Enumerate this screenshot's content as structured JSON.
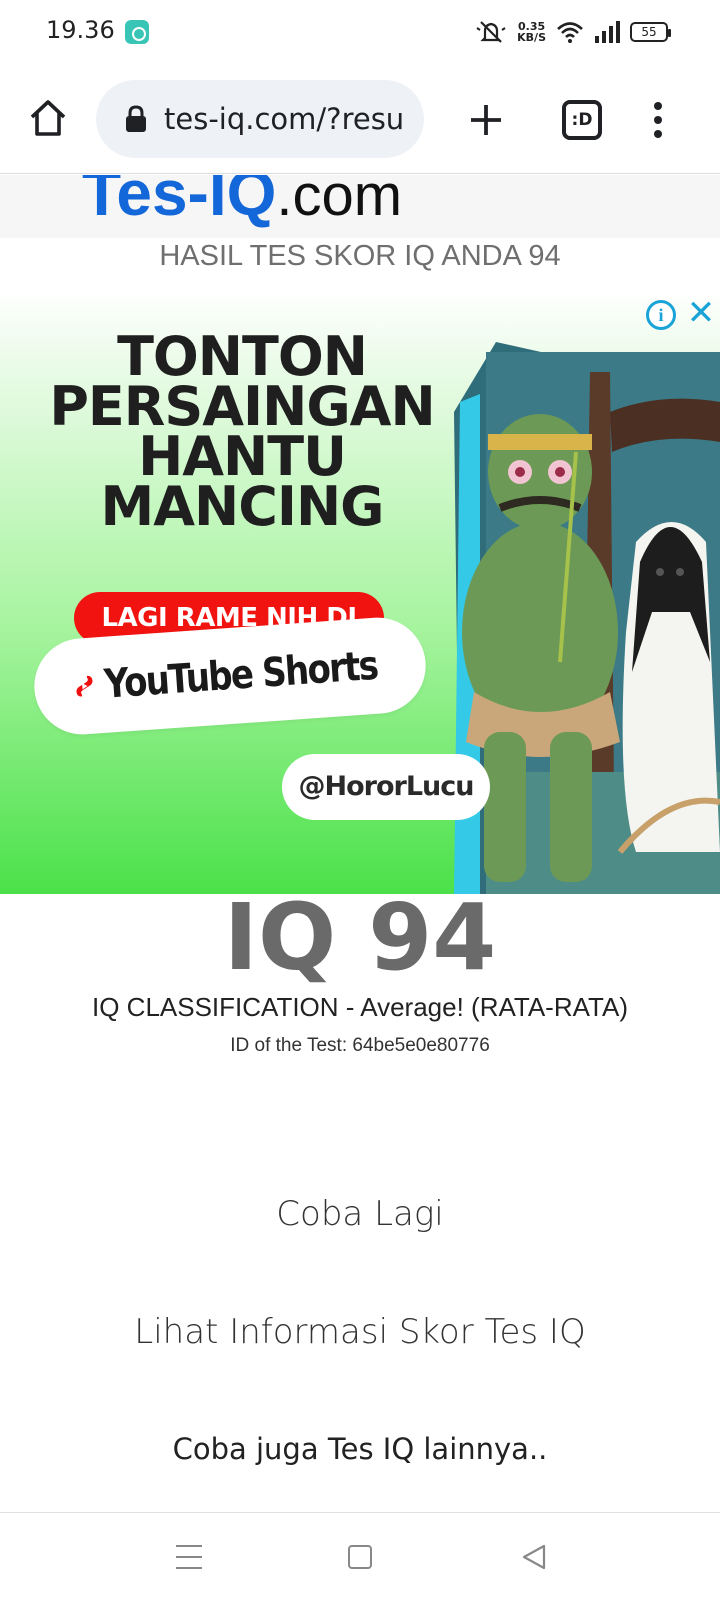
{
  "status_bar": {
    "time": "19.36",
    "net_speed_value": "0.35",
    "net_speed_unit": "KB/S",
    "battery": "55",
    "icons": [
      "app-icon",
      "mute-icon",
      "wifi-icon",
      "signal-icon",
      "battery-icon"
    ]
  },
  "browser": {
    "url": "tes-iq.com/?resu",
    "tabs_label": ":D",
    "icons": [
      "home-icon",
      "lock-icon",
      "plus-icon",
      "tabs-icon",
      "more-vert-icon"
    ]
  },
  "site": {
    "logo_part_1": "Tes-IQ",
    "logo_part_2": ".com",
    "result_heading": "HASIL TES SKOR IQ ANDA 94"
  },
  "ad": {
    "headline_1": "TONTON",
    "headline_2": "PERSAINGAN",
    "headline_3": "HANTU",
    "headline_4": "MANCING",
    "red_pill": "LAGI RAME NIH DI",
    "platform": "YouTube Shorts",
    "handle": "@HororLucu",
    "info_glyph": "i",
    "close_glyph": "✕",
    "colors": {
      "green": "#4be14a",
      "red": "#f1130f",
      "ad_icon": "#1aa3d7"
    }
  },
  "result": {
    "iq_score": "IQ 94",
    "classification": "IQ CLASSIFICATION - Average! (RATA-RATA)",
    "test_id": "ID of the Test: 64be5e0e80776",
    "retry_label": "Coba Lagi",
    "info_label": "Lihat Informasi Skor Tes IQ",
    "more_tests_label": "Coba juga Tes IQ lainnya.."
  },
  "nav_bar": {
    "icons": [
      "recent-apps-icon",
      "home-square-icon",
      "back-triangle-icon"
    ]
  },
  "colors": {
    "logo_blue": "#1467d8",
    "score_gray": "#6a6a6a"
  }
}
